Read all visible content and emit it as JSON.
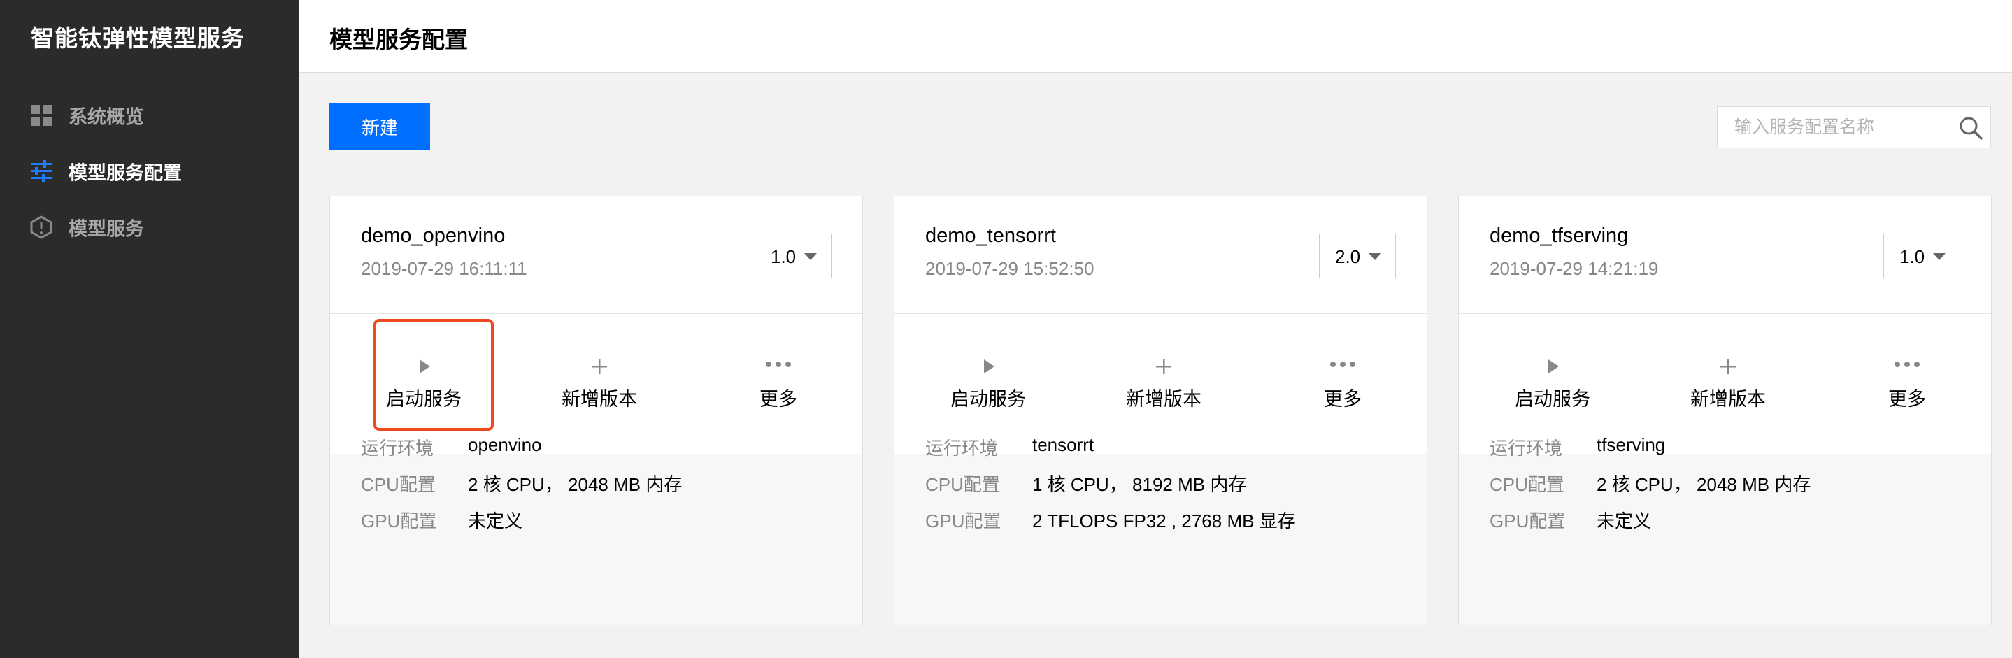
{
  "app": {
    "title": "智能钛弹性模型服务"
  },
  "sidebar": {
    "items": [
      {
        "label": "系统概览",
        "icon": "grid-icon",
        "active": false
      },
      {
        "label": "模型服务配置",
        "icon": "sliders-icon",
        "active": true
      },
      {
        "label": "模型服务",
        "icon": "cube-icon",
        "active": false
      }
    ]
  },
  "header": {
    "title": "模型服务配置"
  },
  "toolbar": {
    "new_label": "新建",
    "search_placeholder": "输入服务配置名称",
    "search_value": ""
  },
  "colors": {
    "accent": "#006eff",
    "sidebar_bg": "#2b2b2b",
    "highlight": "#ee4a1e"
  },
  "cards": [
    {
      "name": "demo_openvino",
      "time": "2019-07-29 16:11:11",
      "version": "1.0",
      "actions": {
        "start": "启动服务",
        "add": "新增版本",
        "more": "更多"
      },
      "details": [
        {
          "key": "运行环境",
          "value": "openvino"
        },
        {
          "key": "CPU配置",
          "value": "2 核 CPU， 2048 MB 内存"
        },
        {
          "key": "GPU配置",
          "value": "未定义"
        }
      ]
    },
    {
      "name": "demo_tensorrt",
      "time": "2019-07-29 15:52:50",
      "version": "2.0",
      "actions": {
        "start": "启动服务",
        "add": "新增版本",
        "more": "更多"
      },
      "details": [
        {
          "key": "运行环境",
          "value": "tensorrt"
        },
        {
          "key": "CPU配置",
          "value": "1 核 CPU， 8192 MB 内存"
        },
        {
          "key": "GPU配置",
          "value": "2 TFLOPS FP32 , 2768 MB 显存"
        }
      ]
    },
    {
      "name": "demo_tfserving",
      "time": "2019-07-29 14:21:19",
      "version": "1.0",
      "actions": {
        "start": "启动服务",
        "add": "新增版本",
        "more": "更多"
      },
      "details": [
        {
          "key": "运行环境",
          "value": "tfserving"
        },
        {
          "key": "CPU配置",
          "value": "2 核 CPU， 2048 MB 内存"
        },
        {
          "key": "GPU配置",
          "value": "未定义"
        }
      ]
    }
  ]
}
